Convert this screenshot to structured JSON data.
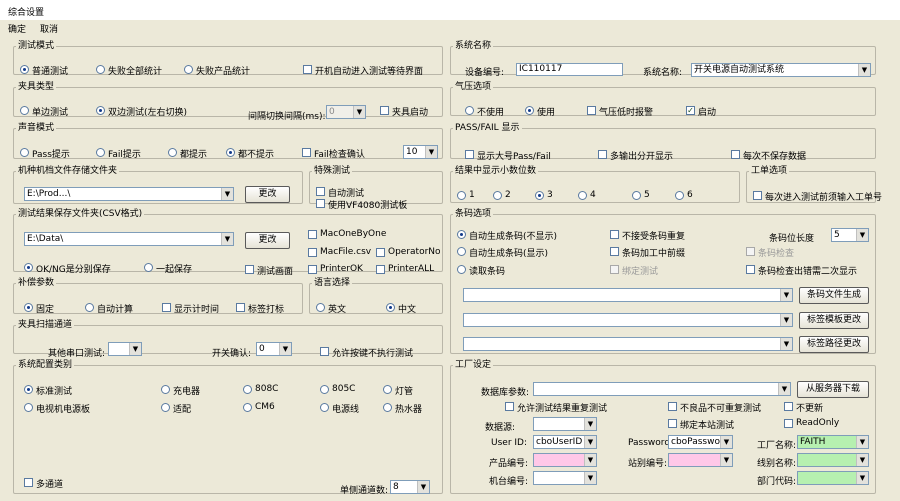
{
  "window": {
    "title": "综合设置"
  },
  "menu": {
    "ok": "确定",
    "cancel": "取消"
  },
  "test_mode": {
    "legend": "测试模式",
    "opt_normal": "普通测试",
    "opt_all_stat": "失败全部统计",
    "opt_product_stat": "失败产品统计",
    "cb_auto_enter": "开机自动进入测试等待界面"
  },
  "cycle_type": {
    "legend": "夹具类型",
    "opt_single": "单边测试",
    "opt_double": "双边测试(左右切换)",
    "lbl_interval": "间隔切换间隔(ms):",
    "interval_value": "0",
    "cb_clamp": "夹具启动"
  },
  "prompt_mode": {
    "legend": "声音模式",
    "opt_pass": "Pass提示",
    "opt_fail": "Fail提示",
    "opt_all": "都提示",
    "opt_none": "都不提示",
    "cb_fail_confirm": "Fail检查确认",
    "confirm_value": "10"
  },
  "lib_path": {
    "legend": "机种机档文件存储文件夹",
    "value": "E:\\Prod...\\",
    "btn": "更改"
  },
  "special_test": {
    "legend": "特殊测试",
    "cb_auto": "自动测试",
    "cb_vf4080": "使用VF4080测试板"
  },
  "save_path": {
    "legend": "测试结果保存文件夹(CSV格式)",
    "value": "E:\\Data\\",
    "btn": "更改",
    "opt_ok_ng": "OK/NG是分别保存",
    "opt_together": "一起保存",
    "cb_test_screen": "测试画面",
    "cb_macoffset": "MacOneByOne",
    "cb_macfile": "MacFile.csv",
    "cb_opno": "OperatorNo",
    "cb_printok": "PrinterOK",
    "cb_printall": "PrinterALL"
  },
  "suffix": {
    "legend": "补偿参数",
    "opt_fixed": "固定",
    "opt_auto": "自动计算",
    "cb_show_time": "显示计时间",
    "cb_lineend": "标签打标"
  },
  "language": {
    "legend": "语言选择",
    "opt_en": "英文",
    "opt_cn": "中文"
  },
  "channel": {
    "legend": "夹具扫描通道",
    "lbl_other_test": "其他串口测试:",
    "other_test_value": "",
    "lbl_switch_confirm": "开关确认:",
    "switch_confirm_value": "0",
    "cb_unplug": "允许按键不执行测试"
  },
  "system_type": {
    "legend": "系统配置类别",
    "opts": [
      "标准测试",
      "充电器",
      "808C",
      "805C",
      "灯管",
      "电视机电源板",
      "适配",
      "CM6",
      "电源线",
      "热水器"
    ],
    "cb_multi": "多通道",
    "lbl_single_count": "单侧通道数:",
    "single_count_value": "8"
  },
  "system_name": {
    "legend": "系统名称",
    "lbl_device_no": "设备编号:",
    "device_no_value": "IC110117",
    "lbl_system_name": "系统名称:",
    "system_name_value": "开关电源自动测试系统"
  },
  "pressure": {
    "legend": "气压选项",
    "opt_unused": "不使用",
    "opt_used": "使用",
    "cb_low_alarm": "气压低时报警",
    "cb_start": "启动"
  },
  "passfail": {
    "legend": "PASS/FAIL 显示",
    "cb_show_big": "显示大号Pass/Fail",
    "cb_multi_show": "多输出分开显示",
    "cb_no_show": "每次不保存数据"
  },
  "decimals": {
    "legend": "结果中显示小数位数",
    "opts": [
      "1",
      "2",
      "3",
      "4",
      "5",
      "6"
    ],
    "selected": "3"
  },
  "workorder": {
    "legend": "工单选项",
    "cb_enter": "每次进入测试前须输入工单号"
  },
  "barcode": {
    "legend": "条码选项",
    "opt_auto_gen": "自动生成条码(不显示)",
    "cb_no_repeat": "不接受条码重复",
    "lbl_length": "条码位长度",
    "length_value": "5",
    "opt_auto_show": "自动生成条码(显示)",
    "cb_process": "条码加工中前缀",
    "cb_check": "条码检查",
    "opt_scan": "读取条码",
    "cb_bind": "绑定测试",
    "cb_manual": "条码检查出错需二次显示",
    "btn_gen_file": "条码文件生成",
    "btn_check_change": "标签模板更改",
    "btn_path_change": "标签路径更改"
  },
  "factory": {
    "legend": "工厂设定",
    "lbl_db": "数据库参数:",
    "btn_download": "从服务器下载",
    "cb_allow_repeat": "允许测试结果重复测试",
    "cb_not_again": "不良品不可重复测试",
    "cb_no_update": "不更新",
    "lbl_source": "数据源:",
    "cb_bind_station": "绑定本站测试",
    "cb_readonly": "ReadOnly",
    "lbl_user_id": "User ID:",
    "user_id_value": "cboUserID",
    "lbl_password": "Password:",
    "password_value": "cboPassword",
    "lbl_fact_no": "工厂名称:",
    "fact_no_value": "FAITH",
    "lbl_product_no": "产品编号:",
    "lbl_station_no": "站别编号:",
    "lbl_line_name": "线别名称:",
    "lbl_machine_no": "机台编号:",
    "lbl_dept_no": "部门代码:"
  }
}
